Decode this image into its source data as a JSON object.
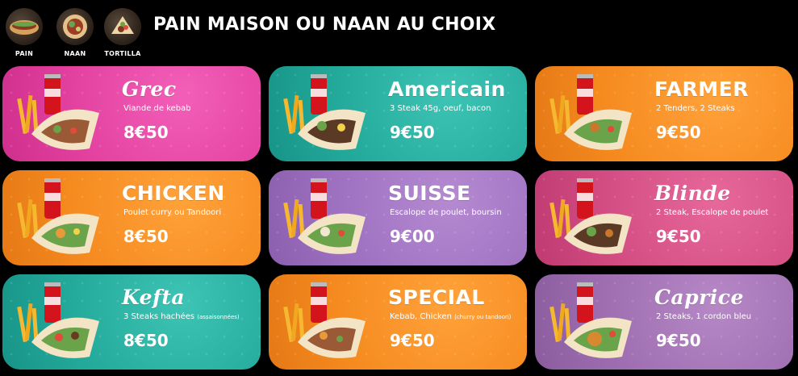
{
  "header": {
    "title": "PAIN MAISON OU NAAN AU CHOIX",
    "breads": [
      {
        "label": "PAIN",
        "icon": "pain-bread-icon"
      },
      {
        "label": "NAAN",
        "icon": "naan-bread-icon"
      },
      {
        "label": "TORTILLA",
        "icon": "tortilla-bread-icon"
      }
    ]
  },
  "menu": [
    {
      "name": "Grec",
      "description": "Viande de kebab",
      "description_small": "",
      "price": "8€50",
      "color": "#e2409f"
    },
    {
      "name": "Americain",
      "description": "3 Steak 45g, oeuf, bacon",
      "description_small": "",
      "price": "9€50",
      "color": "#23a99a"
    },
    {
      "name": "FARMER",
      "description": "2 Tenders, 2 Steaks",
      "description_small": "",
      "price": "9€50",
      "color": "#f58a1f"
    },
    {
      "name": "CHICKEN",
      "description": "Poulet curry ou Tandoori",
      "description_small": "",
      "price": "8€50",
      "color": "#f58a1f"
    },
    {
      "name": "SUISSE",
      "description": "Escalope de poulet, boursin",
      "description_small": "",
      "price": "9€00",
      "color": "#9d70c0"
    },
    {
      "name": "Blinde",
      "description": "2 Steak, Escalope de poulet",
      "description_small": "",
      "price": "9€50",
      "color": "#d24c82"
    },
    {
      "name": "Kefta",
      "description": "3 Steaks hachées",
      "description_small": "(assaisonnées)",
      "price": "8€50",
      "color": "#23a99a"
    },
    {
      "name": "SPECIAL",
      "description": "Kebab, Chicken",
      "description_small": "(churry ou tandoori)",
      "price": "9€50",
      "color": "#f58a1f"
    },
    {
      "name": "Caprice",
      "description": "2 Steaks, 1 cordon bleu",
      "description_small": "",
      "price": "9€50",
      "color": "#9d6db0"
    }
  ],
  "icons": {
    "combo": "sandwich-fries-soda-icon",
    "soda_brand": "Coca-Cola"
  }
}
